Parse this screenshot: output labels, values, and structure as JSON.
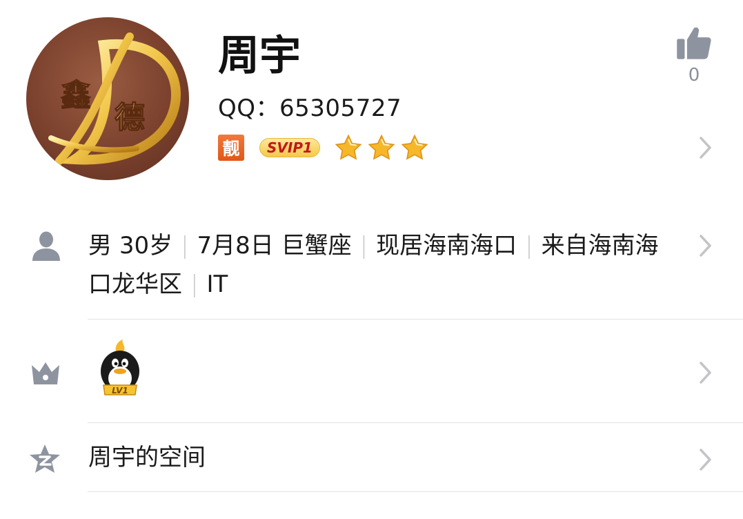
{
  "profile": {
    "avatar_text_1": "鑫",
    "avatar_text_2": "德",
    "avatar_letter": "D",
    "name": "周宇",
    "qq_label": "QQ：",
    "qq_number": "65305727",
    "badge_pretty": "靓",
    "badge_svip": "SVIP1",
    "star_count": 3,
    "like_count": "0"
  },
  "info": {
    "gender": "男",
    "age": "30岁",
    "birthday": "7月8日",
    "zodiac": "巨蟹座",
    "location": "现居海南海口",
    "hometown": "来自海南海口龙华区",
    "occupation": "IT"
  },
  "level": {
    "badge_text": "LV1"
  },
  "space": {
    "label": "周宇的空间"
  },
  "colors": {
    "icon_gray": "#8e93a0",
    "chevron": "#c4c4c8",
    "pretty_badge": "#e8621f",
    "svip_text": "#c2171a",
    "star": "#f6b82a"
  }
}
